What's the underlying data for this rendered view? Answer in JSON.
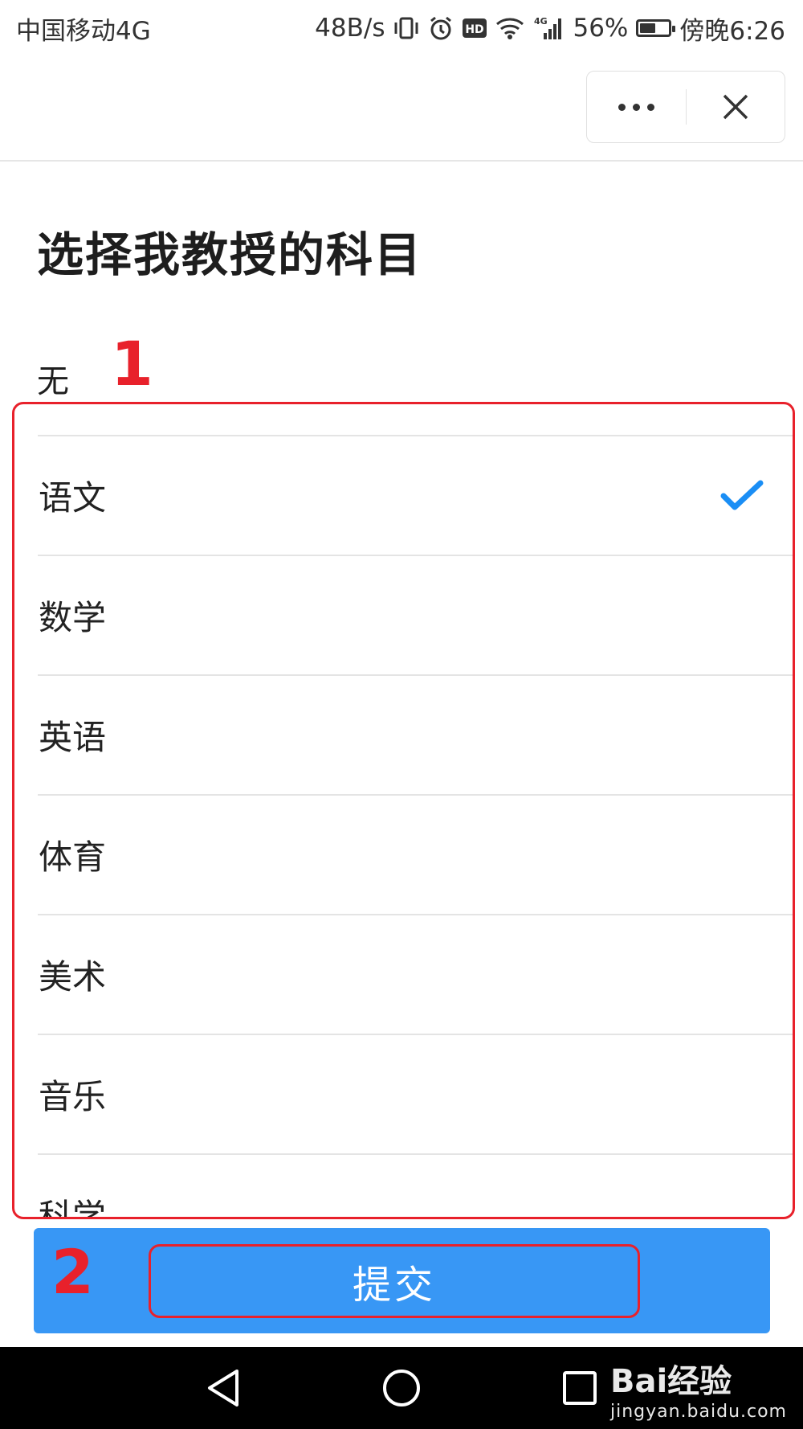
{
  "status_bar": {
    "carrier": "中国移动4G",
    "speed": "48B/s",
    "battery_percent": "56%",
    "time": "傍晚6:26",
    "battery_level": 0.56,
    "icons": [
      "vibrate-icon",
      "alarm-icon",
      "hd-icon",
      "wifi-icon",
      "4g-signal-icon",
      "battery-icon"
    ]
  },
  "capsule": {
    "menu_icon": "more-dots-icon",
    "close_icon": "close-icon"
  },
  "page": {
    "title": "选择我教授的科目",
    "none_label": "无"
  },
  "annotations": {
    "marker_1": "1",
    "marker_2": "2",
    "color": "#e8212b"
  },
  "subjects": [
    {
      "label": "语文",
      "checked": true
    },
    {
      "label": "数学",
      "checked": false
    },
    {
      "label": "英语",
      "checked": false
    },
    {
      "label": "体育",
      "checked": false
    },
    {
      "label": "美术",
      "checked": false
    },
    {
      "label": "音乐",
      "checked": false
    },
    {
      "label": "科学",
      "checked": false
    }
  ],
  "submit": {
    "label": "提交",
    "color": "#3897f5"
  },
  "accent_color": "#1a8ef5",
  "nav": {
    "icons": [
      "back-triangle-icon",
      "home-circle-icon",
      "recents-square-icon"
    ]
  },
  "watermark": {
    "brand": "Bai经验",
    "domain": "jingyan.baidu.com"
  }
}
